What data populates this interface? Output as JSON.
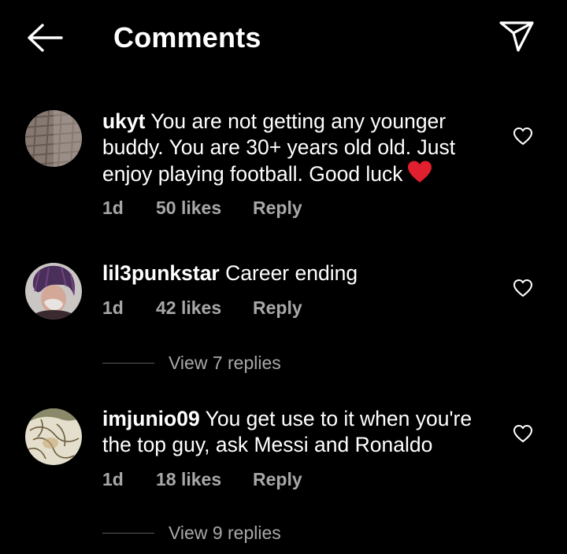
{
  "header": {
    "title": "Comments",
    "back_icon": "arrow-left-icon",
    "share_icon": "paper-plane-icon"
  },
  "comments": [
    {
      "username": "ukyt",
      "text": "You are not getting any younger buddy. You are 30+ years old old. Just enjoy playing football. Good luck",
      "emoji": "red-heart-emoji",
      "time": "1d",
      "likes": "50 likes",
      "reply_label": "Reply"
    },
    {
      "username": "lil3punkstar",
      "text": "Career ending",
      "time": "1d",
      "likes": "42 likes",
      "reply_label": "Reply",
      "view_replies": "View 7 replies"
    },
    {
      "username": "imjunio09",
      "text": "You get use to it when you're the top guy, ask Messi and Ronaldo",
      "time": "1d",
      "likes": "18 likes",
      "reply_label": "Reply",
      "view_replies": "View 9 replies"
    }
  ],
  "colors": {
    "background": "#000000",
    "text": "#ffffff",
    "secondary_text": "#a8a8a8",
    "heart_emoji": "#e0202e"
  }
}
